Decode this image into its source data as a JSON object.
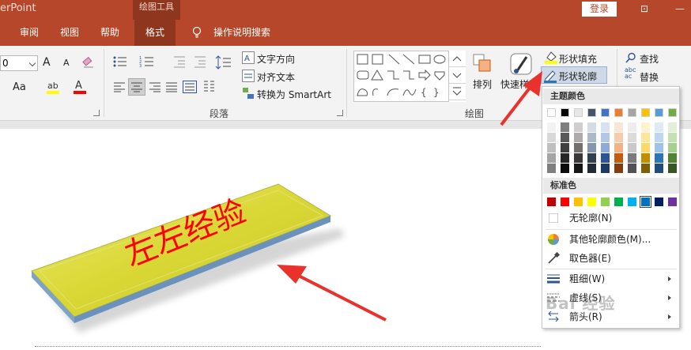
{
  "titlebar": {
    "app_title": "erPoint",
    "context_tab": "绘图工具",
    "login_label": "登录",
    "restore_glyph": "⊡",
    "minimize_glyph": "—",
    "accent": "#b7472a"
  },
  "tabs": {
    "review": "审阅",
    "view": "视图",
    "help": "帮助",
    "format": "格式",
    "tell_me": "操作说明搜索"
  },
  "ribbon": {
    "font_size_value": "0",
    "font_grow": "A",
    "font_shrink": "A",
    "text_case": "Aa",
    "text_direction": "文字方向",
    "align_text": "对齐文本",
    "smartart": "转换为 SmartArt",
    "paragraph_label": "段落",
    "drawing_label": "绘图",
    "arrange": "排列",
    "quick_styles": "快速样式",
    "shape_fill": "形状填充",
    "shape_outline": "形状轮廓",
    "find": "查找",
    "replace": "替换",
    "replace_icon_text": "abc\nac"
  },
  "slide": {
    "shape_text": "左左经验",
    "shape_fill_color": "#d9d735",
    "shape_edge_color": "#7fa3c8",
    "text_color": "#ff0000"
  },
  "menu": {
    "theme_colors_header": "主题颜色",
    "standard_colors_header": "标准色",
    "no_outline": "无轮廓(N)",
    "more_colors": "其他轮廓颜色(M)...",
    "eyedropper": "取色器(E)",
    "weight": "粗细(W)",
    "dashes": "虚线(S)",
    "arrows": "箭头(R)",
    "theme_top_row": [
      "#ffffff",
      "#000000",
      "#e7e6e6",
      "#44546a",
      "#4472c4",
      "#ed7d31",
      "#a5a5a5",
      "#ffc000",
      "#5b9bd5",
      "#70ad47"
    ],
    "theme_shades": [
      [
        "#f2f2f2",
        "#7f7f7f",
        "#d0cece",
        "#d6dce4",
        "#d9e2f3",
        "#fbe5d5",
        "#ededed",
        "#fff2cc",
        "#deebf6",
        "#e2efd9"
      ],
      [
        "#d8d8d8",
        "#595959",
        "#aeabab",
        "#adb9ca",
        "#b4c6e7",
        "#f7cbac",
        "#dbdbdb",
        "#fee599",
        "#bdd7ee",
        "#c5e0b3"
      ],
      [
        "#bfbfbf",
        "#3f3f3f",
        "#757070",
        "#8496b0",
        "#8eaadb",
        "#f4b183",
        "#c9c9c9",
        "#ffd965",
        "#9dc3e6",
        "#a8d08d"
      ],
      [
        "#a5a5a5",
        "#262626",
        "#3a3838",
        "#323f4f",
        "#2f5496",
        "#c55a11",
        "#7b7b7b",
        "#bf8f00",
        "#2e75b5",
        "#538135"
      ],
      [
        "#7f7f7f",
        "#0c0c0c",
        "#171616",
        "#222a35",
        "#1f3864",
        "#833c0b",
        "#525252",
        "#7f6000",
        "#1e4e79",
        "#375623"
      ]
    ],
    "standard": [
      "#c00000",
      "#ff0000",
      "#ffc000",
      "#ffff00",
      "#92d050",
      "#00b050",
      "#00b0f0",
      "#0070c0",
      "#002060",
      "#7030a0"
    ],
    "selected_standard_index": 7
  },
  "annotations": {
    "arrow_color": "#e8322b"
  },
  "watermark": {
    "text": "Bai 经验"
  }
}
